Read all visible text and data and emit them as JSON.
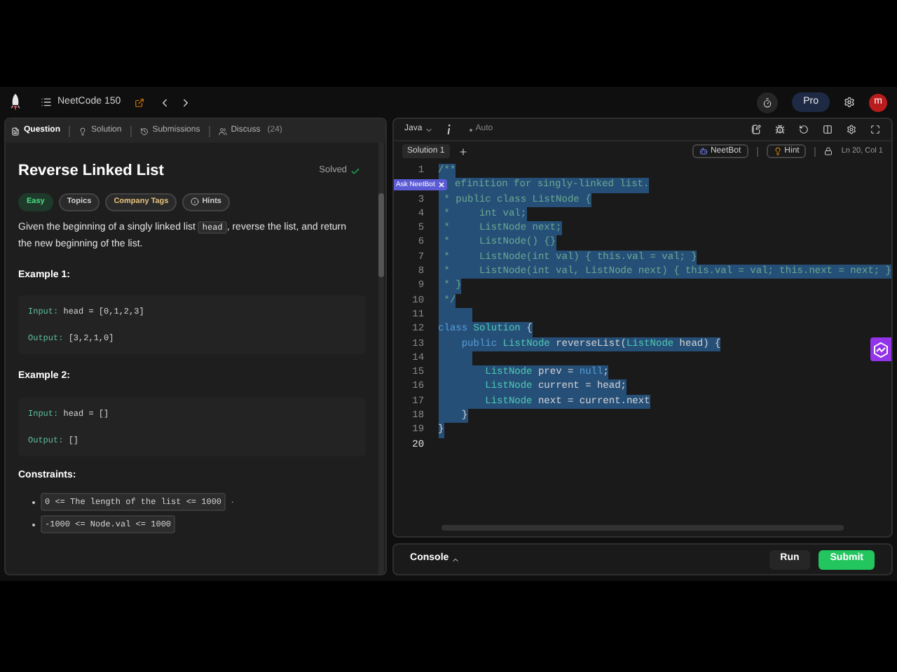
{
  "header": {
    "list_title": "NeetCode 150",
    "pro": "Pro",
    "avatar": "m"
  },
  "tabs": [
    {
      "label": "Question",
      "selected": true
    },
    {
      "label": "Solution",
      "selected": false
    },
    {
      "label": "Submissions",
      "selected": false
    },
    {
      "label": "Discuss",
      "count": "(24)",
      "selected": false
    }
  ],
  "problem": {
    "title": "Reverse Linked List",
    "status": "Solved",
    "tags": [
      {
        "label": "Easy",
        "kind": "difficulty"
      },
      {
        "label": "Topics",
        "kind": "plain"
      },
      {
        "label": "Company Tags",
        "kind": "company"
      },
      {
        "label": "Hints",
        "kind": "hint"
      }
    ],
    "description": [
      {
        "text": "Given the beginning of a singly linked list ",
        "kind": "text"
      },
      {
        "text": "head",
        "kind": "code"
      },
      {
        "text": ", reverse the list, and return the new beginning of the list.",
        "kind": "text"
      }
    ],
    "examples": [
      {
        "title": "Example 1:",
        "input_label": "Input:",
        "input": "head = [0,1,2,3]",
        "output_label": "Output:",
        "output": "[3,2,1,0]"
      },
      {
        "title": "Example 2:",
        "input_label": "Input:",
        "input": "head = []",
        "output_label": "Output:",
        "output": "[]"
      }
    ],
    "constraints_title": "Constraints:",
    "constraints": [
      {
        "code": "0 <= The length of the list <= 1000",
        "after": "."
      },
      {
        "code": "-1000 <= Node.val <= 1000"
      }
    ]
  },
  "editor": {
    "language": "Java",
    "mode": "Auto",
    "file_tab": "Solution 1",
    "neetbot": "NeetBot",
    "hint": "Hint",
    "position": "Ln 20, Col 1",
    "ask_badge": "Ask NeetBot",
    "lines": [
      {
        "number": "1",
        "selected": true,
        "tokens": [
          {
            "text": "/**",
            "kind": "comment"
          }
        ]
      },
      {
        "hidden_by_badge": true,
        "selected": true,
        "tokens": [
          {
            "text": "efinition for singly-linked list.",
            "kind": "comment"
          }
        ]
      },
      {
        "number": "3",
        "selected": true,
        "tokens": [
          {
            "text": " * public class ListNode {",
            "kind": "comment"
          }
        ]
      },
      {
        "number": "4",
        "selected": true,
        "tokens": [
          {
            "text": " *     int val;",
            "kind": "comment"
          }
        ]
      },
      {
        "number": "5",
        "selected": true,
        "tokens": [
          {
            "text": " *     ListNode next;",
            "kind": "comment"
          }
        ]
      },
      {
        "number": "6",
        "selected": true,
        "tokens": [
          {
            "text": " *     ListNode() {}",
            "kind": "comment"
          }
        ]
      },
      {
        "number": "7",
        "selected": true,
        "tokens": [
          {
            "text": " *     ListNode(int val) { this.val = val; }",
            "kind": "comment"
          }
        ]
      },
      {
        "number": "8",
        "selected": true,
        "tokens": [
          {
            "text": " *     ListNode(int val, ListNode next) { this.val = val; this.next = next; }",
            "kind": "comment"
          }
        ]
      },
      {
        "number": "9",
        "selected": true,
        "tokens": [
          {
            "text": " * }",
            "kind": "comment"
          }
        ]
      },
      {
        "number": "10",
        "selected": true,
        "tokens": [
          {
            "text": " */",
            "kind": "comment"
          }
        ]
      },
      {
        "number": "11",
        "selected": true
      },
      {
        "number": "12",
        "selected": true,
        "tokens": [
          {
            "text": "class",
            "kind": "keyword"
          },
          {
            "text": " Solution",
            "kind": "type"
          },
          {
            "text": " {",
            "kind": "plain"
          }
        ]
      },
      {
        "number": "13",
        "selected": true,
        "tokens": [
          {
            "text": "    public",
            "kind": "keyword"
          },
          {
            "text": " ListNode",
            "kind": "type"
          },
          {
            "text": " reverseList(",
            "kind": "plain"
          },
          {
            "text": "ListNode",
            "kind": "type"
          },
          {
            "text": " head) {",
            "kind": "plain"
          }
        ]
      },
      {
        "number": "14",
        "selected": true
      },
      {
        "number": "15",
        "selected": true,
        "tokens": [
          {
            "text": "        ListNode",
            "kind": "type"
          },
          {
            "text": " prev = ",
            "kind": "plain"
          },
          {
            "text": "null",
            "kind": "keyword"
          },
          {
            "text": ";",
            "kind": "plain"
          }
        ]
      },
      {
        "number": "16",
        "selected": true,
        "tokens": [
          {
            "text": "        ListNode",
            "kind": "type"
          },
          {
            "text": " current = head;",
            "kind": "plain"
          }
        ]
      },
      {
        "number": "17",
        "selected": true,
        "tokens": [
          {
            "text": "        ListNode",
            "kind": "type"
          },
          {
            "text": " next = current.next",
            "kind": "plain"
          }
        ]
      },
      {
        "number": "18",
        "selected": true,
        "tokens": [
          {
            "text": "    }",
            "kind": "plain"
          }
        ]
      },
      {
        "number": "19",
        "selected": true,
        "tokens": [
          {
            "text": "}",
            "kind": "plain"
          }
        ]
      },
      {
        "number": "20",
        "selected": false
      }
    ]
  },
  "console": {
    "label": "Console",
    "run": "Run",
    "submit": "Submit"
  }
}
